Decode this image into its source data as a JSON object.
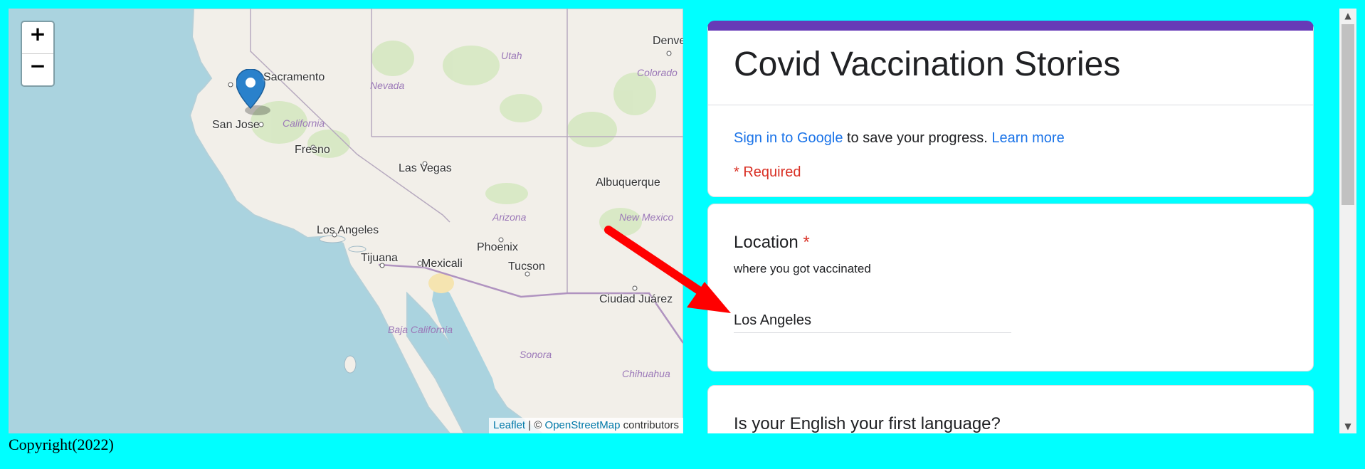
{
  "map": {
    "zoom_in": "+",
    "zoom_out": "−",
    "attribution": {
      "leaflet": "Leaflet",
      "sep": " | © ",
      "osm": "OpenStreetMap",
      "contributors": " contributors"
    },
    "cities": {
      "sacramento": "Sacramento",
      "san_jose": "San Jose",
      "fresno": "Fresno",
      "las_vegas": "Las Vegas",
      "los_angeles": "Los Angeles",
      "tijuana": "Tijuana",
      "mexicali": "Mexicali",
      "phoenix": "Phoenix",
      "tucson": "Tucson",
      "albuquerque": "Albuquerque",
      "ciudad_juarez": "Ciudad Juárez",
      "denver": "Denver"
    },
    "regions": {
      "utah": "Utah",
      "nevada": "Nevada",
      "colorado": "Colorado",
      "california": "California",
      "arizona": "Arizona",
      "new_mexico": "New Mexico",
      "baja_california": "Baja California",
      "sonora": "Sonora",
      "chihuahua": "Chihuahua"
    },
    "marker_icon": "map-pin-icon"
  },
  "form": {
    "title": "Covid Vaccination Stories",
    "signin_link": "Sign in to Google",
    "signin_text": " to save your progress. ",
    "learn_more": "Learn more",
    "required_note": "* Required",
    "questions": [
      {
        "title": "Location",
        "required_star": "*",
        "description": "where you got vaccinated",
        "answer": "Los Angeles"
      },
      {
        "title": "Is your English your first language?"
      }
    ],
    "accent_color": "#673ab7"
  },
  "footer": {
    "copyright": "Copyright(2022)"
  },
  "colors": {
    "background": "#00ffff",
    "arrow": "#ff0000"
  }
}
